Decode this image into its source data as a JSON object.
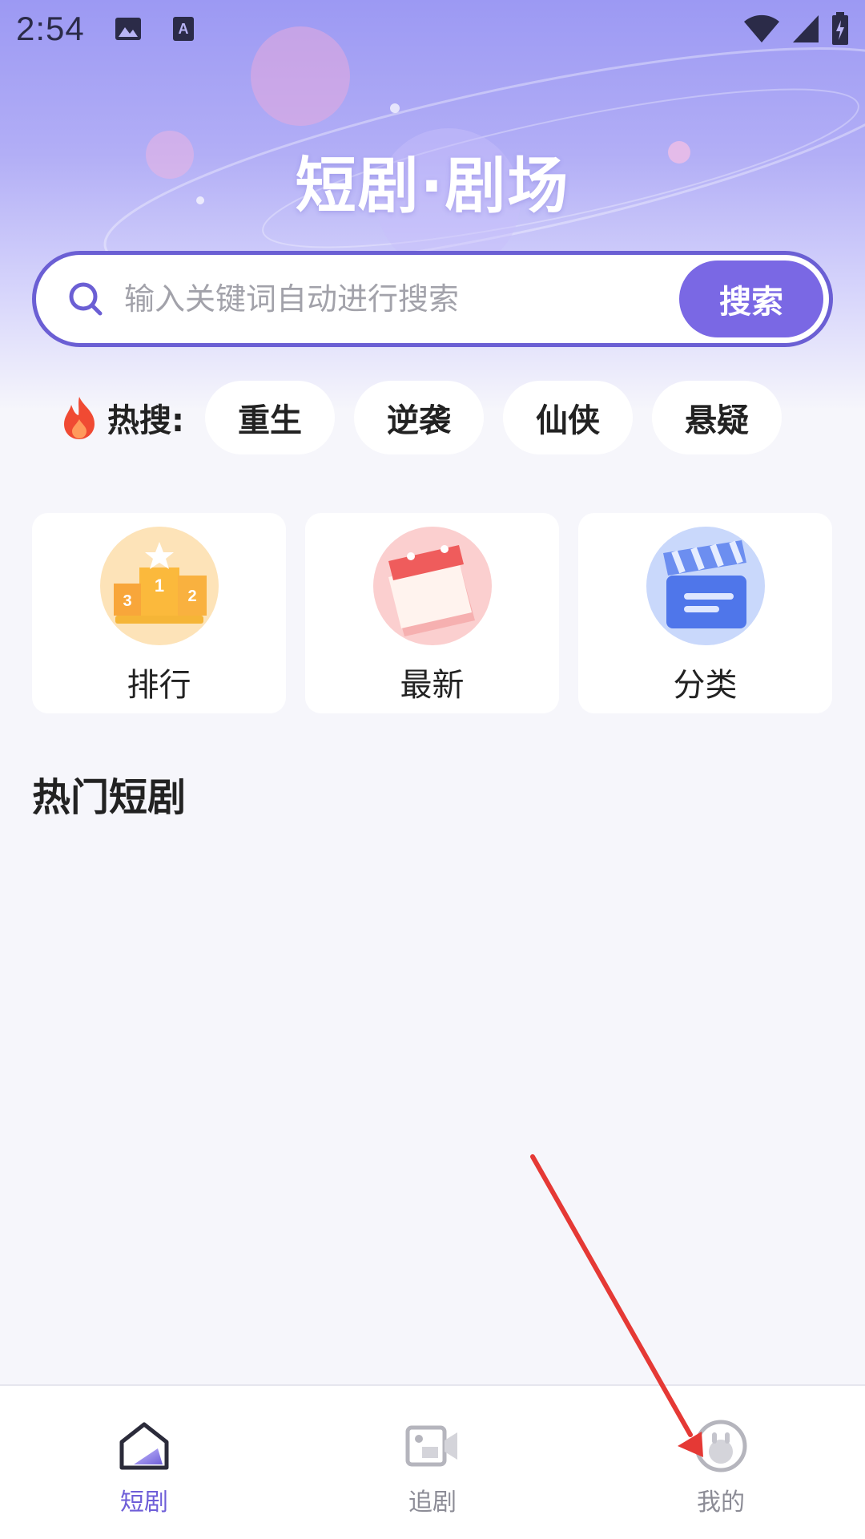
{
  "status_bar": {
    "time": "2:54"
  },
  "header": {
    "title": "短剧·剧场"
  },
  "search": {
    "placeholder": "输入关键词自动进行搜索",
    "button_label": "搜索"
  },
  "hot_search": {
    "label": "热搜:",
    "tags": [
      "重生",
      "逆袭",
      "仙侠",
      "悬疑"
    ]
  },
  "categories": [
    {
      "label": "排行",
      "icon": "podium-icon"
    },
    {
      "label": "最新",
      "icon": "calendar-icon"
    },
    {
      "label": "分类",
      "icon": "clapperboard-icon"
    }
  ],
  "section": {
    "title": "热门短剧"
  },
  "bottom_nav": {
    "items": [
      {
        "label": "短剧",
        "icon": "home-icon",
        "active": true
      },
      {
        "label": "追剧",
        "icon": "video-camera-icon",
        "active": false
      },
      {
        "label": "我的",
        "icon": "profile-icon",
        "active": false
      }
    ]
  },
  "colors": {
    "accent": "#7a68e4",
    "active_tab": "#6e5ed8",
    "annotation_arrow": "#e53935"
  }
}
